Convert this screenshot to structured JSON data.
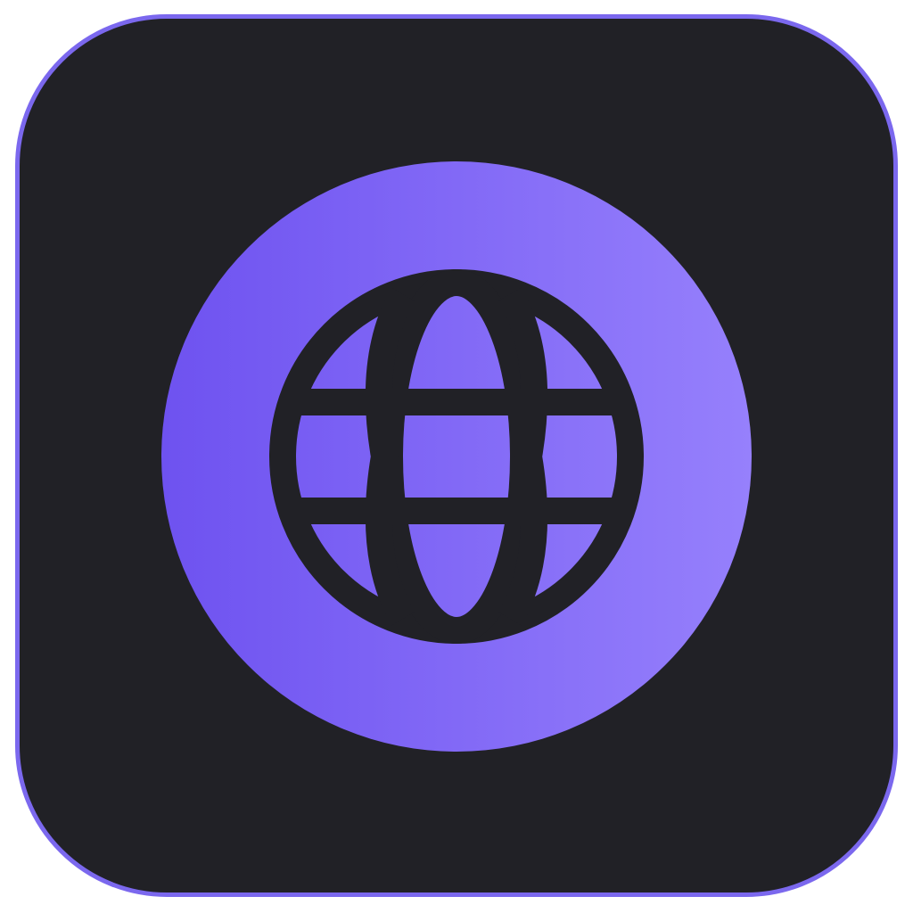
{
  "icon": {
    "name": "globe-icon",
    "colors": {
      "tile_background": "#212126",
      "tile_border": "#7B68EE",
      "disc_gradient_start": "#6E52F0",
      "disc_gradient_end": "#9680FC",
      "globe_stroke": "#212126"
    }
  }
}
